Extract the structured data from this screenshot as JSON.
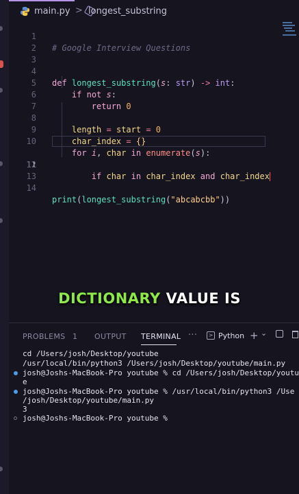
{
  "tabbar": {
    "file_label": "main.py",
    "separator": ">",
    "symbol_label": "longest_substring"
  },
  "editor": {
    "line_numbers": [
      "1",
      "2",
      "3",
      "4",
      "5",
      "6",
      "7",
      "8",
      "9",
      "10",
      "11",
      "12",
      "13",
      "14"
    ],
    "active_line": "11",
    "comment": "# Google Interview Questions",
    "code": {
      "def_kw": "def",
      "func_name": "longest_substring",
      "param": "s",
      "param_type": "str",
      "arrow": "->",
      "return_type": "int",
      "if_kw": "if",
      "not_kw": "not",
      "return_kw": "return",
      "zero": "0",
      "length_var": "length",
      "start_var": "start",
      "char_index_var": "char_index",
      "empty_dict": "{}",
      "for_kw": "for",
      "i_var": "i",
      "char_var": "char",
      "in_kw": "in",
      "enumerate_fn": "enumerate",
      "and_kw": "and",
      "print_fn": "print",
      "string_arg": "\"abcabcbb\""
    }
  },
  "caption": {
    "highlight": "DICTIONARY",
    "rest": "VALUE IS"
  },
  "panel": {
    "tabs": {
      "problems": "PROBLEMS",
      "problems_count": "1",
      "output": "OUTPUT",
      "terminal": "TERMINAL",
      "more": "···"
    },
    "interpreter": "Python",
    "add": "+",
    "split": "⌄"
  },
  "terminal": {
    "lines": [
      "cd /Users/josh/Desktop/youtube",
      "/usr/local/bin/python3 /Users/josh/Desktop/youtube/main.py",
      "josh@Joshs-MacBook-Pro youtube % cd /Users/josh/Desktop/youtub",
      "e",
      "josh@Joshs-MacBook-Pro youtube % /usr/local/bin/python3 /Use",
      "/josh/Desktop/youtube/main.py",
      "3",
      "josh@Joshs-MacBook-Pro youtube % "
    ]
  },
  "colors": {
    "background": "#16141f",
    "caption_highlight": "#8fe84a",
    "active_tab_accent": "#b494e8"
  }
}
